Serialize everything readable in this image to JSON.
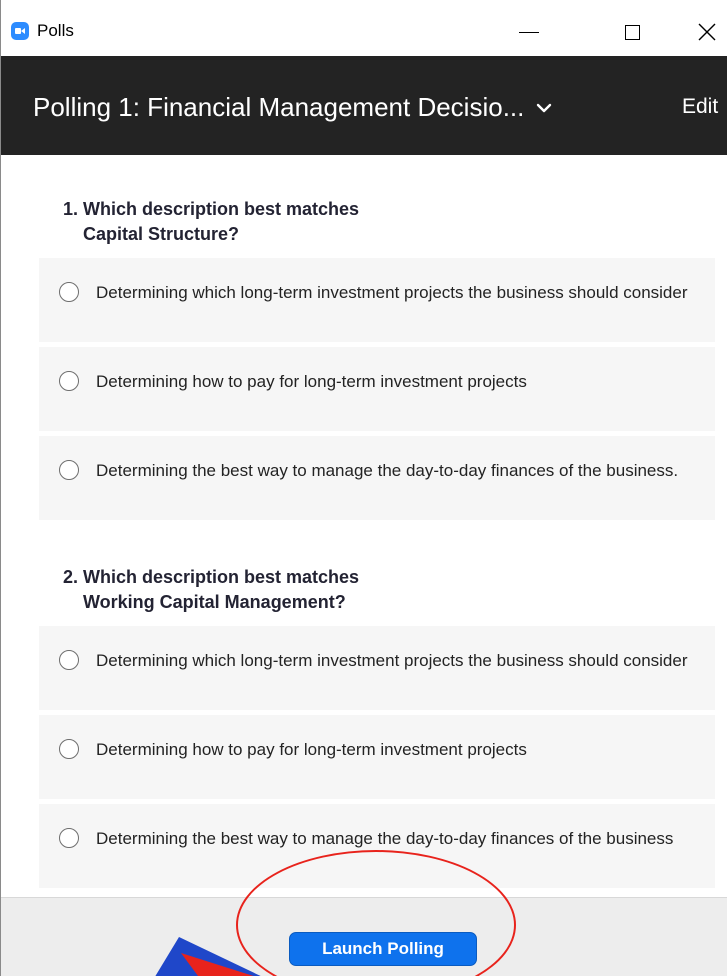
{
  "window": {
    "title": "Polls",
    "app_icon": "zoom-camera-icon",
    "controls": [
      "minimize-icon",
      "maximize-icon",
      "close-icon"
    ]
  },
  "header": {
    "poll_title": "Polling 1: Financial Management Decisio...",
    "edit_label": "Edit"
  },
  "questions": [
    {
      "line1": "1. Which description best matches",
      "line2": "Capital Structure?",
      "options": [
        "Determining which long-term investment projects the business should consider",
        "Determining how to pay for long-term investment projects",
        "Determining the best way to manage the day-to-day finances of the business."
      ]
    },
    {
      "line1": "2. Which description best matches",
      "line2": "Working Capital Management?",
      "options": [
        "Determining which long-term investment projects the business should consider",
        "Determining how to pay for long-term investment projects",
        "Determining the best way to manage the day-to-day finances of the business"
      ]
    }
  ],
  "footer": {
    "launch_label": "Launch Polling"
  },
  "colors": {
    "header_bg": "#232323",
    "accent": "#0e72ed",
    "annotation": "#e8231c"
  }
}
